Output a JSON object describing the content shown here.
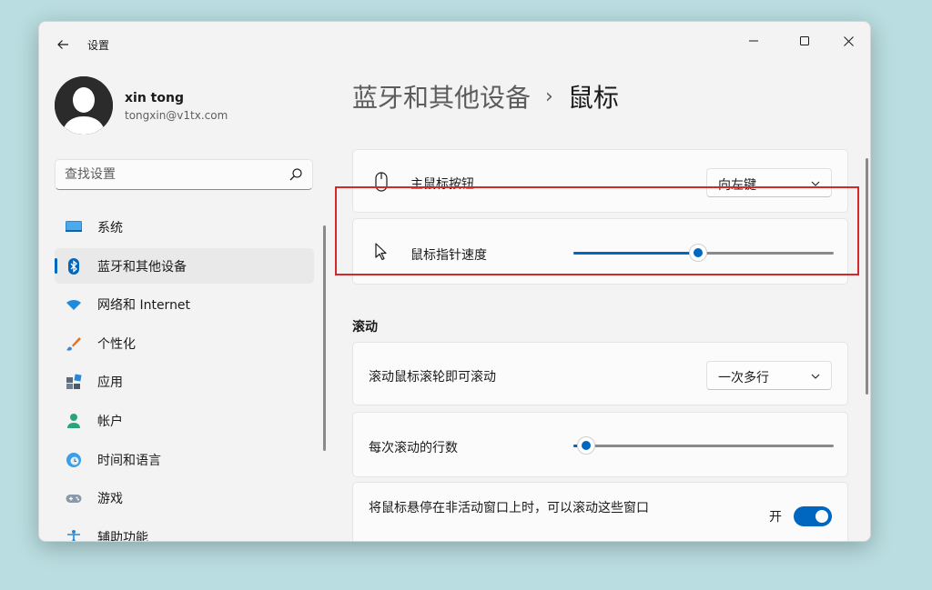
{
  "window": {
    "app_title": "设置",
    "controls": {
      "minimize": "minimize-icon",
      "maximize": "maximize-icon",
      "close": "close-icon"
    }
  },
  "user": {
    "name": "xin tong",
    "email": "tongxin@v1tx.com"
  },
  "search": {
    "placeholder": "查找设置"
  },
  "sidebar": {
    "items": [
      {
        "label": "系统",
        "icon": "system-icon",
        "active": false
      },
      {
        "label": "蓝牙和其他设备",
        "icon": "bluetooth-icon",
        "active": true
      },
      {
        "label": "网络和 Internet",
        "icon": "wifi-icon",
        "active": false
      },
      {
        "label": "个性化",
        "icon": "brush-icon",
        "active": false
      },
      {
        "label": "应用",
        "icon": "apps-icon",
        "active": false
      },
      {
        "label": "帐户",
        "icon": "account-icon",
        "active": false
      },
      {
        "label": "时间和语言",
        "icon": "globe-icon",
        "active": false
      },
      {
        "label": "游戏",
        "icon": "gamepad-icon",
        "active": false
      },
      {
        "label": "辅助功能",
        "icon": "accessibility-icon",
        "active": false
      }
    ]
  },
  "breadcrumb": {
    "parent": "蓝牙和其他设备",
    "separator": "›",
    "current": "鼠标"
  },
  "mouse": {
    "primary_button": {
      "label": "主鼠标按钮",
      "value": "向左键",
      "icon": "mouse-icon"
    },
    "pointer_speed": {
      "label": "鼠标指针速度",
      "icon": "pointer-icon",
      "level": 0.48
    }
  },
  "scrolling": {
    "section_title": "滚动",
    "scroll_wheel": {
      "label": "滚动鼠标滚轮即可滚动",
      "value": "一次多行"
    },
    "lines_per_scroll": {
      "label": "每次滚动的行数",
      "level": 0.05
    },
    "inactive_scroll": {
      "label": "将鼠标悬停在非活动窗口上时，可以滚动这些窗口",
      "state": "开",
      "on": true
    }
  },
  "colors": {
    "accent": "#0067c0",
    "highlight_box": "#d22a2a",
    "background": "#b9dde0"
  }
}
